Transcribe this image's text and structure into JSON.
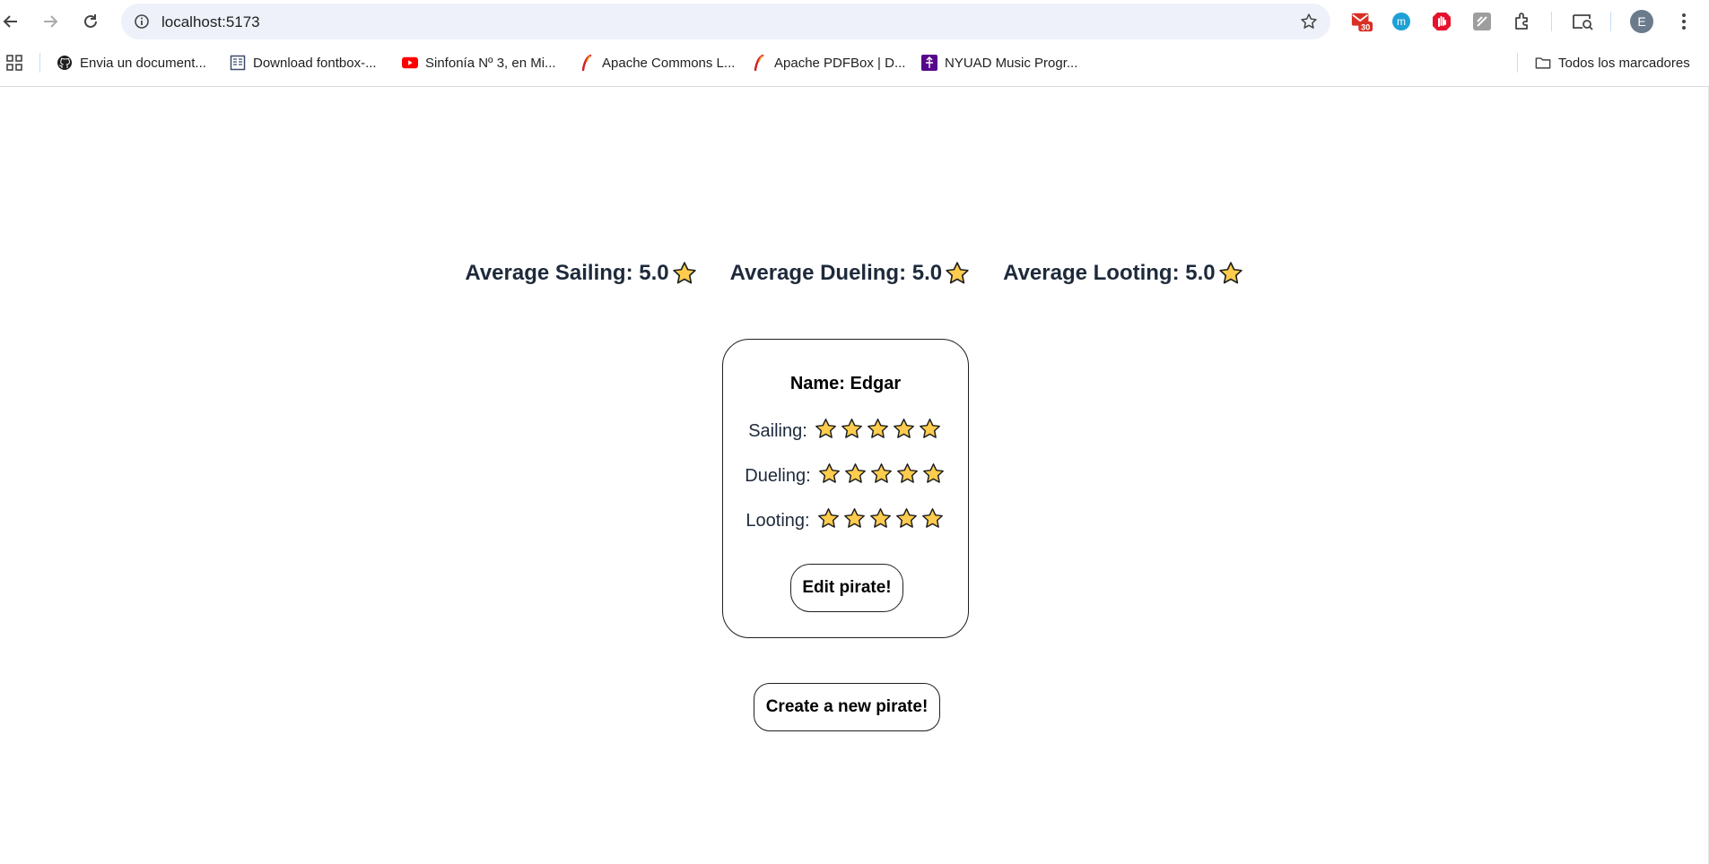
{
  "browser": {
    "url": "localhost:5173",
    "profile_initial": "E",
    "extensions": [
      {
        "name": "mail-extension",
        "badge": "30",
        "color": "#d93025"
      },
      {
        "name": "m-extension",
        "label": "m",
        "color": "#1da1d6"
      },
      {
        "name": "hand-extension",
        "color": "#e8112d"
      },
      {
        "name": "edit-extension",
        "color": "#9e9e9e"
      }
    ],
    "bookmarks": [
      {
        "label": "Envia un document...",
        "icon": "github-icon"
      },
      {
        "label": "Download fontbox-...",
        "icon": "document-icon"
      },
      {
        "label": "Sinfonía Nº 3, en Mi...",
        "icon": "youtube-icon"
      },
      {
        "label": "Apache Commons L...",
        "icon": "apache-feather-icon"
      },
      {
        "label": "Apache PDFBox | D...",
        "icon": "apache-feather-icon"
      },
      {
        "label": "NYUAD Music Progr...",
        "icon": "nyuad-icon"
      }
    ],
    "all_bookmarks_label": "Todos los marcadores"
  },
  "averages": [
    {
      "label": "Average Sailing: 5.0"
    },
    {
      "label": "Average Dueling: 5.0"
    },
    {
      "label": "Average Looting: 5.0"
    }
  ],
  "pirate": {
    "name_label": "Name: Edgar",
    "ratings": [
      {
        "label": "Sailing:",
        "stars": 5
      },
      {
        "label": "Dueling:",
        "stars": 5
      },
      {
        "label": "Looting:",
        "stars": 5
      }
    ],
    "edit_label": "Edit pirate!"
  },
  "create_label": "Create a new pirate!",
  "colors": {
    "star_fill": "#ffcc4d",
    "star_stroke": "#1f1f1f",
    "heading": "#1e2a3b"
  }
}
